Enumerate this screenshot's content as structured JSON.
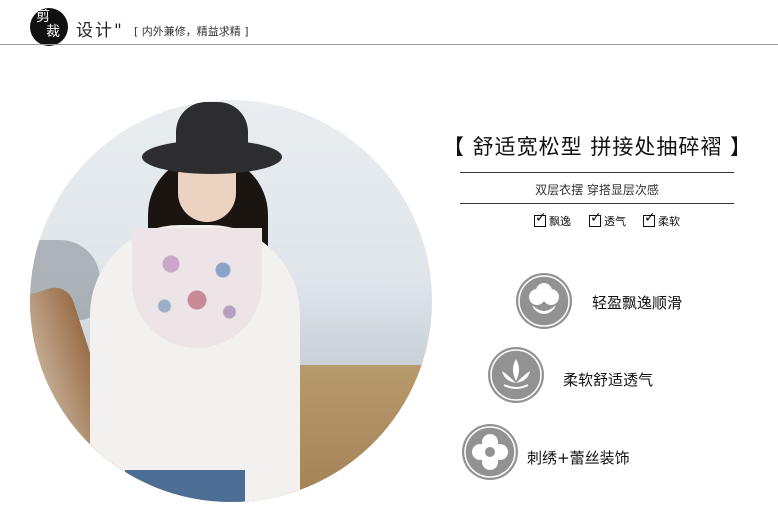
{
  "header": {
    "badge_char_1": "剪",
    "badge_char_2": "裁",
    "title": "设计\"",
    "slogan": "[ 内外兼修，精益求精 ]"
  },
  "headline": "【 舒适宽松型 拼接处抽碎褶 】",
  "subline": "双层衣摆  穿搭显层次感",
  "checks": [
    {
      "label": "飘逸"
    },
    {
      "label": "透气"
    },
    {
      "label": "柔软"
    }
  ],
  "features": [
    {
      "icon": "cotton-icon",
      "label": "轻盈飘逸顺滑"
    },
    {
      "icon": "lotus-icon",
      "label": "柔软舒适透气"
    },
    {
      "icon": "flower-icon",
      "label": "刺绣+蕾丝装饰"
    }
  ],
  "colors": {
    "icon_circle": "#929292",
    "badge": "#111111"
  }
}
